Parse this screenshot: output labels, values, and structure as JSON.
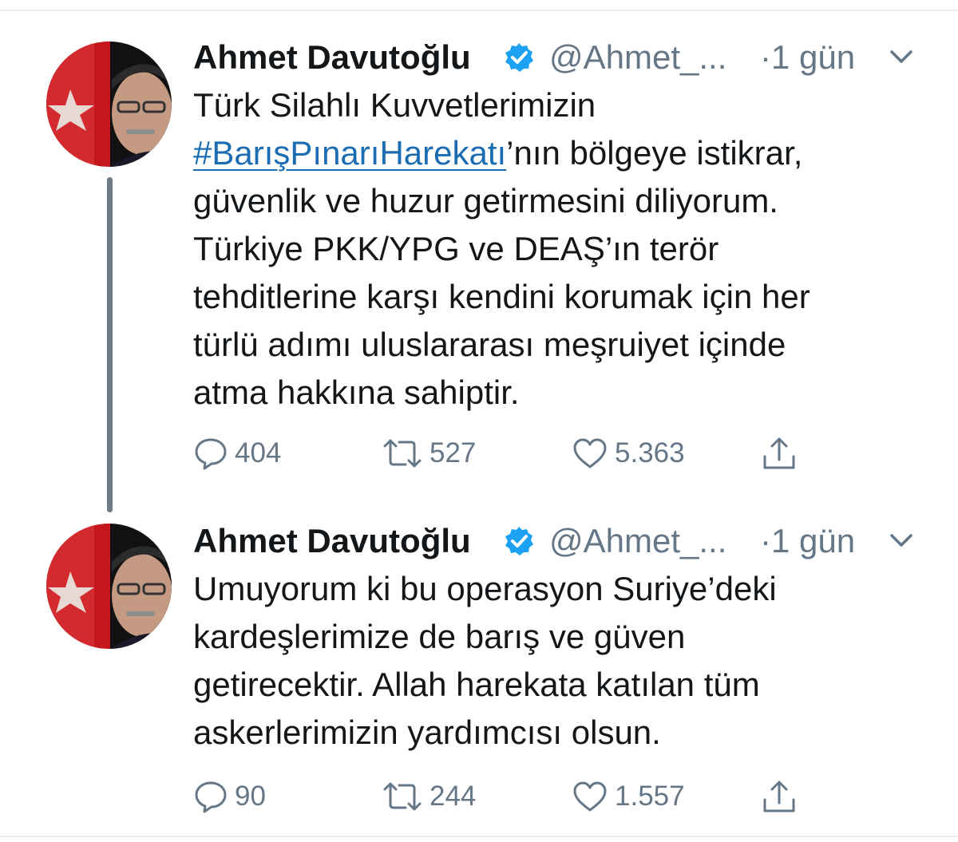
{
  "tweets": [
    {
      "author_name": "Ahmet Davutoğlu",
      "handle": "@Ahmet_...",
      "time": "·1 gün",
      "text_lines": [
        "Türk Silahlı Kuvvetlerimizin",
        "’nın bölgeye istikrar,",
        "güvenlik ve huzur getirmesini diliyorum.",
        "Türkiye PKK/YPG ve DEAŞ’ın terör",
        "tehditlerine karşı kendini korumak için her",
        "türlü adımı uluslararası meşruiyet içinde",
        "atma hakkına sahiptir."
      ],
      "hashtag": "#BarışPınarıHarekatı",
      "replies": "404",
      "retweets": "527",
      "likes": "5.363"
    },
    {
      "author_name": "Ahmet Davutoğlu",
      "handle": "@Ahmet_...",
      "time": "·1 gün",
      "text_lines": [
        "Umuyorum ki bu operasyon Suriye’deki",
        "kardeşlerimize de barış ve güven",
        "getirecektir. Allah harekata katılan tüm",
        "askerlerimizin yardımcısı olsun."
      ],
      "replies": "90",
      "retweets": "244",
      "likes": "1.557"
    }
  ],
  "colors": {
    "text": "#14171a",
    "secondary": "#657786",
    "verified": "#1da1f2",
    "hashtag": "#1b6db3",
    "thread_line": "#6e7b87"
  },
  "icons": [
    "verified-badge-icon",
    "chevron-down-icon",
    "reply-icon",
    "retweet-icon",
    "like-icon",
    "share-icon"
  ]
}
